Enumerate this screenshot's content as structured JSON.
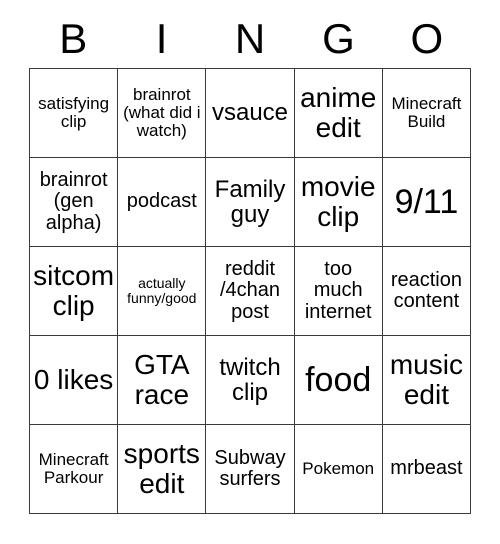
{
  "card": {
    "header": {
      "letters": [
        "B",
        "I",
        "N",
        "G",
        "O"
      ]
    },
    "rows": [
      [
        {
          "text": "satisfying clip",
          "size": "fs-s"
        },
        {
          "text": "brainrot (what did i watch)",
          "size": "fs-s"
        },
        {
          "text": "vsauce",
          "size": "fs-l"
        },
        {
          "text": "anime edit",
          "size": "fs-xl"
        },
        {
          "text": "Minecraft Build",
          "size": "fs-s"
        }
      ],
      [
        {
          "text": "brainrot (gen alpha)",
          "size": "fs-m"
        },
        {
          "text": "podcast",
          "size": "fs-m"
        },
        {
          "text": "Family guy",
          "size": "fs-l"
        },
        {
          "text": "movie clip",
          "size": "fs-xl"
        },
        {
          "text": "9/11",
          "size": "fs-xxl"
        }
      ],
      [
        {
          "text": "sitcom clip",
          "size": "fs-xl"
        },
        {
          "text": "actually funny/good",
          "size": "fs-xs"
        },
        {
          "text": "reddit /4chan post",
          "size": "fs-m"
        },
        {
          "text": "too much internet",
          "size": "fs-m"
        },
        {
          "text": "reaction content",
          "size": "fs-m"
        }
      ],
      [
        {
          "text": "0 likes",
          "size": "fs-xl"
        },
        {
          "text": "GTA race",
          "size": "fs-xl"
        },
        {
          "text": "twitch clip",
          "size": "fs-l"
        },
        {
          "text": "food",
          "size": "fs-xxl"
        },
        {
          "text": "music edit",
          "size": "fs-xl"
        }
      ],
      [
        {
          "text": "Minecraft Parkour",
          "size": "fs-s"
        },
        {
          "text": "sports edit",
          "size": "fs-xl"
        },
        {
          "text": "Subway surfers",
          "size": "fs-m"
        },
        {
          "text": "Pokemon",
          "size": "fs-s"
        },
        {
          "text": "mrbeast",
          "size": "fs-m"
        }
      ]
    ]
  }
}
